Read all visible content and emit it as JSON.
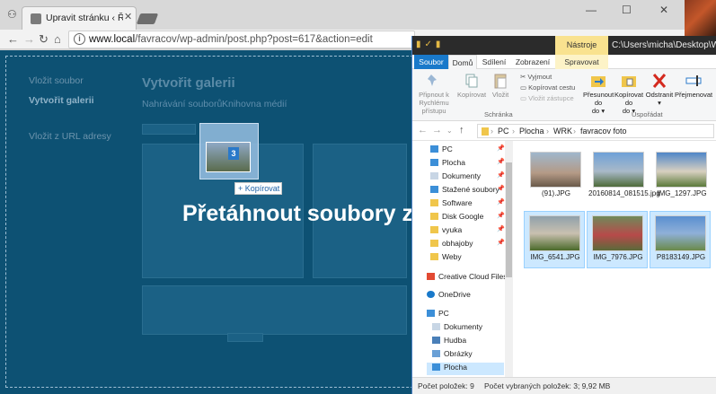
{
  "browser": {
    "tab_title": "Upravit stránku ‹ Římsko",
    "tab_close": "✕",
    "url_domain": "www.local",
    "url_path": "/favracov/wp-admin/post.php?post=617&action=edit",
    "win_min": "—",
    "win_max": "☐",
    "win_close": "✕"
  },
  "wp": {
    "sidebar": [
      "Vložit soubor",
      "Vytvořit galerii",
      "Vložit z URL adresy"
    ],
    "title": "Vytvořit galerii",
    "tabs": [
      "Nahrávání souborů",
      "Knihovna médií"
    ],
    "drop_message": "Přetáhnout soubory z",
    "drag_count": "3",
    "copy_tooltip": "+ Kopírovat"
  },
  "explorer": {
    "title_context": "Nástroje obrázků",
    "title_path": "C:\\Users\\micha\\Desktop\\WRK\\favr",
    "tabs": [
      "Soubor",
      "Domů",
      "Sdílení",
      "Zobrazení",
      "Spravovat"
    ],
    "ribbon": {
      "pin": "Připnout k Rychlému přístupu",
      "copy": "Kopírovat",
      "paste": "Vložit",
      "cut": "Vyjmout",
      "copy_path": "Kopírovat cestu",
      "paste_shortcut": "Vložit zástupce",
      "group_clipboard": "Schránka",
      "move_to": "Přesunout do",
      "copy_to": "Kopírovat do",
      "delete": "Odstranit",
      "rename": "Přejmenovat",
      "group_organize": "Uspořádat"
    },
    "breadcrumb": [
      "PC",
      "Plocha",
      "WRK",
      "favracov foto"
    ],
    "tree": [
      {
        "label": "PC",
        "pinned": true
      },
      {
        "label": "Plocha",
        "pinned": true
      },
      {
        "label": "Dokumenty",
        "pinned": true
      },
      {
        "label": "Stažené soubory",
        "pinned": true
      },
      {
        "label": "Software",
        "pinned": true
      },
      {
        "label": "Disk Google",
        "pinned": true
      },
      {
        "label": "vyuka",
        "pinned": true
      },
      {
        "label": "obhajoby",
        "pinned": true
      },
      {
        "label": "Weby",
        "pinned": false
      },
      {
        "label": "Creative Cloud Files",
        "pinned": false
      },
      {
        "label": "OneDrive",
        "pinned": false
      },
      {
        "label": "PC",
        "pinned": false
      },
      {
        "label": "Dokumenty",
        "pinned": false
      },
      {
        "label": "Hudba",
        "pinned": false
      },
      {
        "label": "Obrázky",
        "pinned": false
      },
      {
        "label": "Plocha",
        "pinned": false
      }
    ],
    "files": [
      {
        "name": "(91).JPG",
        "selected": false
      },
      {
        "name": "20160814_081515.jpg",
        "selected": false
      },
      {
        "name": "IMG_1297.JPG",
        "selected": false
      },
      {
        "name": "IMG_6541.JPG",
        "selected": true
      },
      {
        "name": "IMG_7976.JPG",
        "selected": true
      },
      {
        "name": "P8183149.JPG",
        "selected": true
      }
    ],
    "status_count": "Počet položek: 9",
    "status_selected": "Počet vybraných položek: 3; 9,92 MB"
  }
}
